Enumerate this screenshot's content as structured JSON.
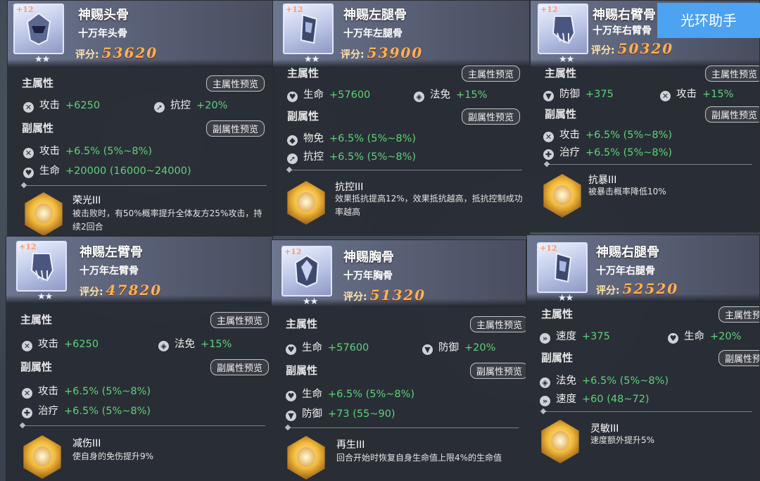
{
  "helper_button": "光环助手",
  "common": {
    "level_badge": "+12",
    "stars": "★★",
    "score_label": "评分:",
    "main_section": "主属性",
    "sub_section": "副属性",
    "main_preview": "主属性预览",
    "sub_preview": "副属性预览"
  },
  "cards": [
    {
      "name": "神赐头骨",
      "sub": "十万年头骨",
      "score": "53620",
      "main": [
        {
          "icon": "attack-icon",
          "label": "攻击",
          "value": "+6250"
        },
        {
          "icon": "control-resist-icon",
          "label": "抗控",
          "value": "+20%"
        }
      ],
      "subs": [
        {
          "icon": "attack-icon",
          "label": "攻击",
          "value": "+6.5% (5%~8%)"
        },
        {
          "icon": "health-icon",
          "label": "生命",
          "value": "+20000 (16000~24000)"
        }
      ],
      "skill": {
        "name": "荣光III",
        "desc": "被击败时，有50%概率提升全体友方25%攻击，持续2回合"
      }
    },
    {
      "name": "神赐左腿骨",
      "sub": "十万年左腿骨",
      "score": "53900",
      "main": [
        {
          "icon": "health-icon",
          "label": "生命",
          "value": "+57600"
        },
        {
          "icon": "magic-immune-icon",
          "label": "法免",
          "value": "+15%"
        }
      ],
      "subs": [
        {
          "icon": "physical-immune-icon",
          "label": "物免",
          "value": "+6.5% (5%~8%)"
        },
        {
          "icon": "control-resist-icon",
          "label": "抗控",
          "value": "+6.5% (5%~8%)"
        }
      ],
      "skill": {
        "name": "抗控III",
        "desc": "效果抵抗提高12%，效果抵抗越高，抵抗控制成功率越高"
      }
    },
    {
      "name": "神赐右臂骨",
      "sub": "十万年右臂骨",
      "score": "50320",
      "main": [
        {
          "icon": "defense-icon",
          "label": "防御",
          "value": "+375"
        },
        {
          "icon": "attack-icon",
          "label": "攻击",
          "value": "+15%"
        }
      ],
      "subs": [
        {
          "icon": "attack-icon",
          "label": "攻击",
          "value": "+6.5% (5%~8%)"
        },
        {
          "icon": "heal-icon",
          "label": "治疗",
          "value": "+6.5% (5%~8%)"
        }
      ],
      "skill": {
        "name": "抗暴III",
        "desc": "被暴击概率降低10%"
      }
    },
    {
      "name": "神赐左臂骨",
      "sub": "十万年左臂骨",
      "score": "47820",
      "main": [
        {
          "icon": "attack-icon",
          "label": "攻击",
          "value": "+6250"
        },
        {
          "icon": "magic-immune-icon",
          "label": "法免",
          "value": "+15%"
        }
      ],
      "subs": [
        {
          "icon": "attack-icon",
          "label": "攻击",
          "value": "+6.5% (5%~8%)"
        },
        {
          "icon": "heal-icon",
          "label": "治疗",
          "value": "+6.5% (5%~8%)"
        }
      ],
      "skill": {
        "name": "减伤III",
        "desc": "使自身的免伤提升9%"
      }
    },
    {
      "name": "神赐胸骨",
      "sub": "十万年胸骨",
      "score": "51320",
      "main": [
        {
          "icon": "health-icon",
          "label": "生命",
          "value": "+57600"
        },
        {
          "icon": "defense-icon",
          "label": "防御",
          "value": "+20%"
        }
      ],
      "subs": [
        {
          "icon": "health-icon",
          "label": "生命",
          "value": "+6.5% (5%~8%)"
        },
        {
          "icon": "defense-icon",
          "label": "防御",
          "value": "+73 (55~90)"
        }
      ],
      "skill": {
        "name": "再生III",
        "desc": "回合开始时恢复自身生命值上限4%的生命值"
      }
    },
    {
      "name": "神赐右腿骨",
      "sub": "十万年右腿骨",
      "score": "52520",
      "main": [
        {
          "icon": "speed-icon",
          "label": "速度",
          "value": "+375"
        },
        {
          "icon": "health-icon",
          "label": "生命",
          "value": "+20%"
        }
      ],
      "subs": [
        {
          "icon": "magic-immune-icon",
          "label": "法免",
          "value": "+6.5% (5%~8%)"
        },
        {
          "icon": "speed-icon",
          "label": "速度",
          "value": "+60 (48~72)"
        }
      ],
      "skill": {
        "name": "灵敏III",
        "desc": "速度额外提升5%"
      }
    }
  ]
}
